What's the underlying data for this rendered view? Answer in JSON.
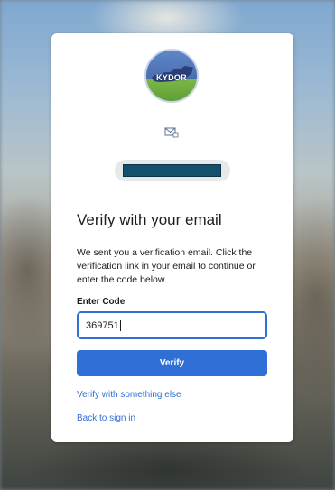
{
  "logo": {
    "text": "KYDOR"
  },
  "heading": "Verify with your email",
  "description": "We sent you a verification email. Click the verification link in your email to continue or enter the code below.",
  "code": {
    "label": "Enter Code",
    "value": "369751"
  },
  "buttons": {
    "verify": "Verify"
  },
  "links": {
    "verify_other": "Verify with something else",
    "back": "Back to sign in"
  },
  "colors": {
    "accent": "#2f6fd6",
    "masked_email": "#14506b"
  },
  "icons": {
    "factor": "mail-icon"
  }
}
